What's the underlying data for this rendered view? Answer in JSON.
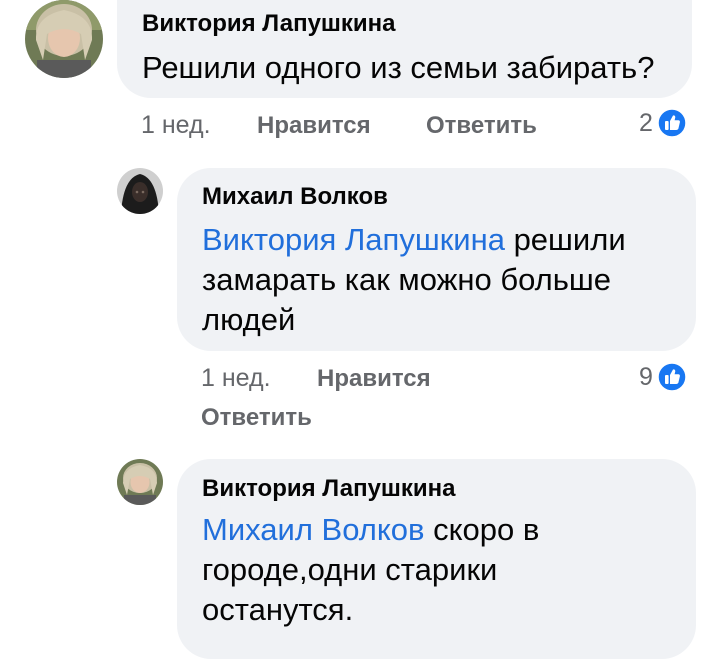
{
  "comments": [
    {
      "author": "Виктория Лапушкина",
      "text": "Решили одного из семьи забирать?",
      "time": "1 нед.",
      "like_label": "Нравится",
      "reply_label": "Ответить",
      "reactions": "2"
    },
    {
      "author": "Михаил Волков",
      "mention": "Виктория Лапушкина",
      "text_line1": "решили",
      "text_line2": "замарать как можно больше",
      "text_line3": "людей",
      "time": "1 нед.",
      "like_label": "Нравится",
      "reply_label": "Ответить",
      "reactions": "9"
    },
    {
      "author": "Виктория Лапушкина",
      "mention": "Михаил Волков",
      "text_line1": "скоро в",
      "text_line2": "городе,одни старики",
      "text_line3": "останутся."
    }
  ],
  "colors": {
    "bubble": "#f0f2f5",
    "mention": "#216fdb",
    "meta": "#65676b",
    "like_badge": "#1877f2"
  },
  "icons": {
    "reaction": "like-thumb-icon"
  }
}
